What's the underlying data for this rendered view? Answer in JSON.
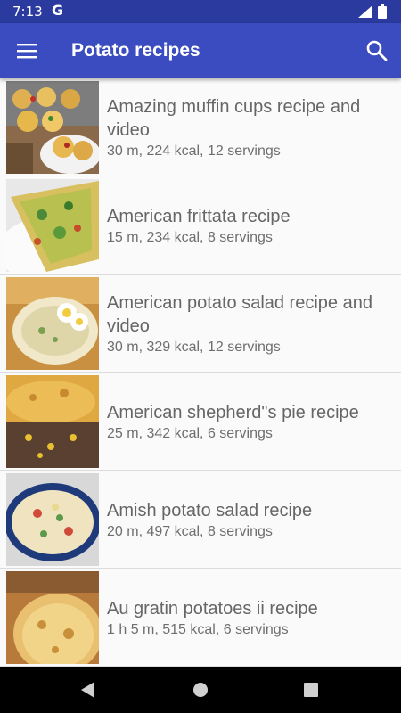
{
  "status": {
    "time": "7:13",
    "g_icon": "G"
  },
  "appbar": {
    "title": "Potato recipes",
    "menu_icon": "menu-icon",
    "search_icon": "search-icon",
    "color": "#3b4cc0"
  },
  "recipes": [
    {
      "title": "Amazing muffin cups recipe and video",
      "meta": "30 m, 224 kcal, 12 servings"
    },
    {
      "title": "American frittata recipe",
      "meta": "15 m, 234 kcal, 8 servings"
    },
    {
      "title": "American potato salad recipe and video",
      "meta": "30 m, 329 kcal, 12 servings"
    },
    {
      "title": "American shepherd\"s pie recipe",
      "meta": "25 m, 342 kcal, 6 servings"
    },
    {
      "title": "Amish potato salad recipe",
      "meta": "20 m, 497 kcal, 8 servings"
    },
    {
      "title": "Au gratin potatoes ii recipe",
      "meta": "1 h 5 m, 515 kcal, 6 servings"
    }
  ],
  "navbar": {
    "back_icon": "back-icon",
    "home_icon": "home-icon",
    "recents_icon": "recents-icon"
  }
}
